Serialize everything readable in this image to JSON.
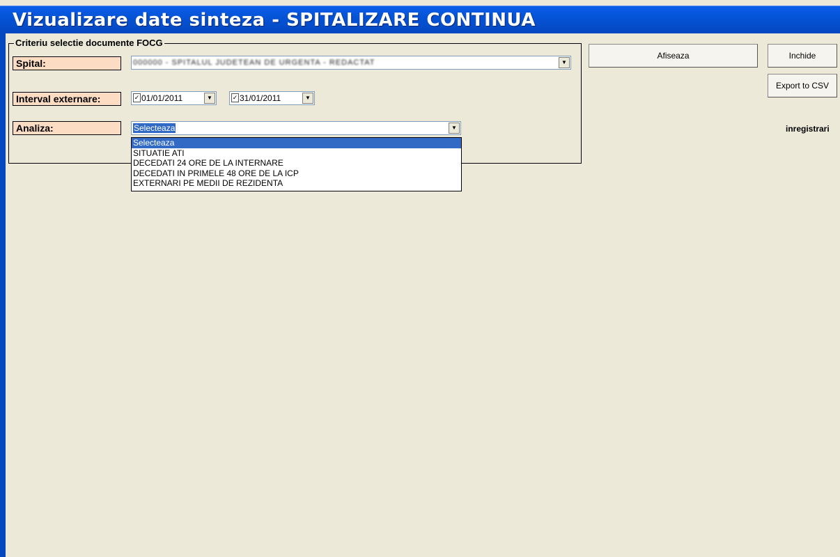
{
  "window": {
    "title": "Vizualizare date sinteza - SPITALIZARE CONTINUA"
  },
  "criteria": {
    "group_title": "Criteriu selectie documente FOCG",
    "spital_label": "Spital:",
    "spital_value": "000000 - SPITALUL JUDETEAN DE URGENTA - REDACTAT",
    "interval_label": "Interval externare:",
    "date_from": "01/01/2011",
    "date_from_checked": true,
    "date_to": "31/01/2011",
    "date_to_checked": true,
    "analiza_label": "Analiza:",
    "analiza_value": "Selecteaza",
    "analiza_options": [
      "Selecteaza",
      "SITUATIE ATI",
      "DECEDATI 24 ORE DE LA INTERNARE",
      "DECEDATI IN PRIMELE 48 ORE DE LA ICP",
      "EXTERNARI PE MEDII DE REZIDENTA"
    ]
  },
  "buttons": {
    "show": "Afiseaza",
    "close": "Inchide",
    "export": "Export to CSV"
  },
  "records_label": "inregistrari",
  "icons": {
    "dropdown_arrow": "triangle-down",
    "checkbox": "check"
  }
}
